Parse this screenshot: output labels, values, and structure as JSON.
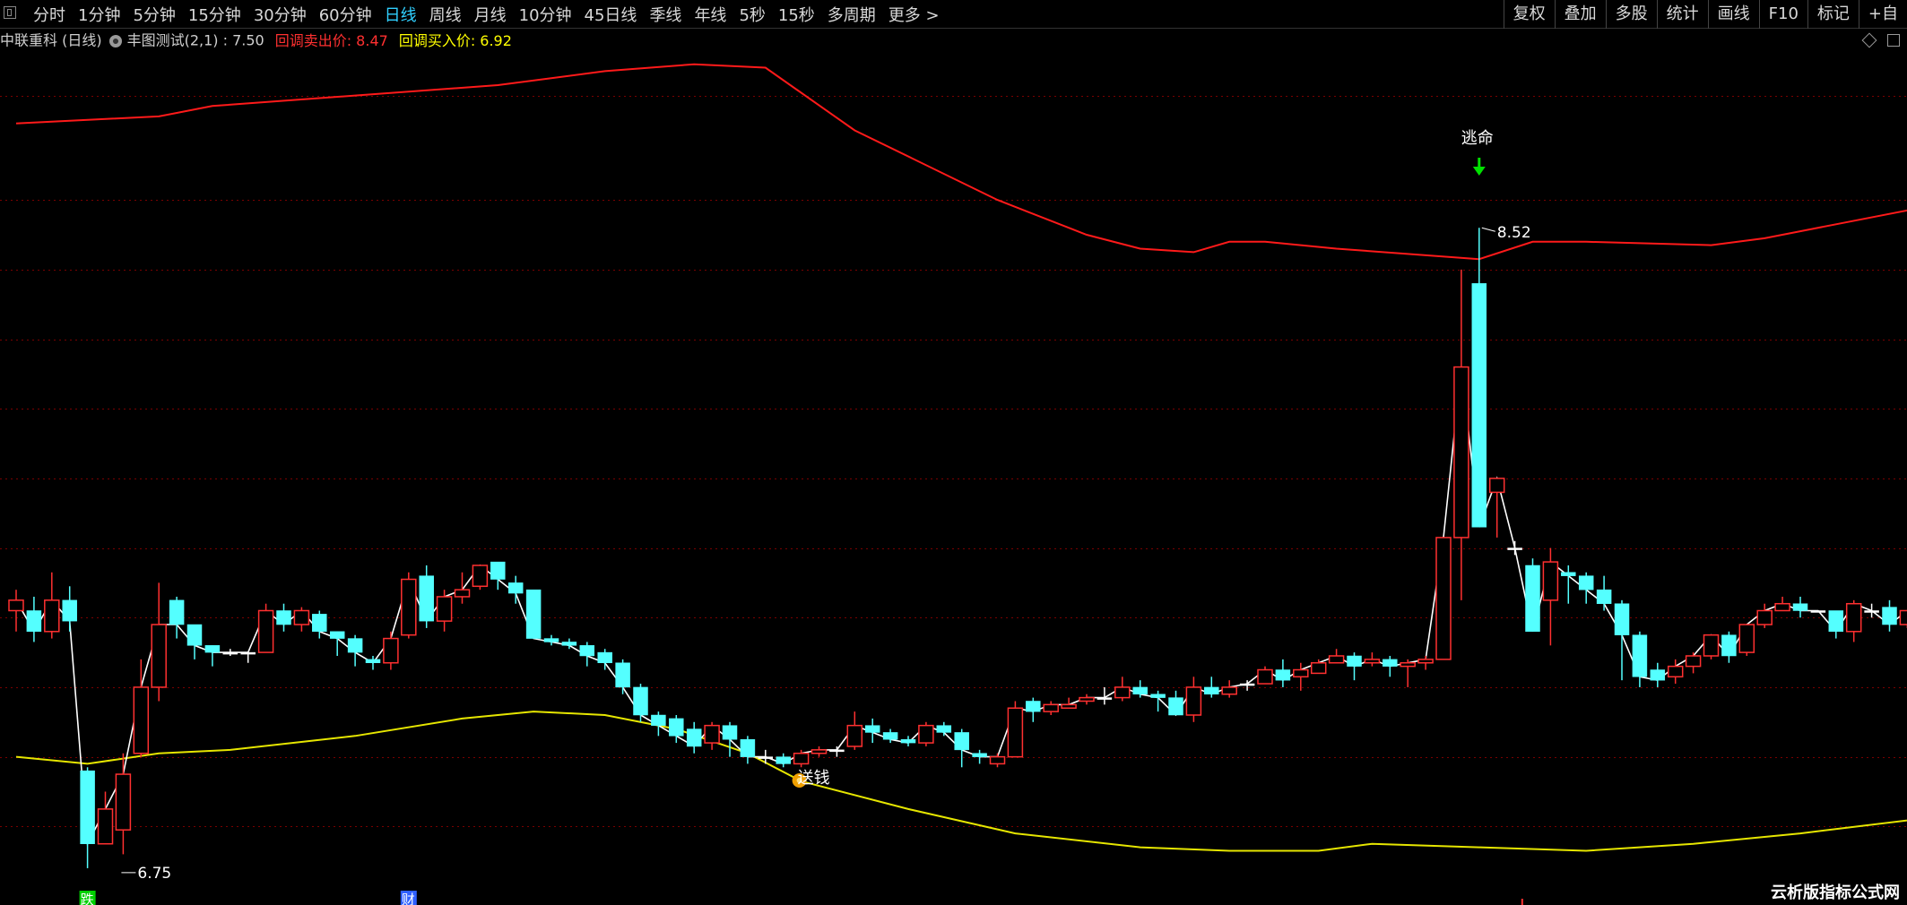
{
  "toolbar": {
    "periods": [
      "分时",
      "1分钟",
      "5分钟",
      "15分钟",
      "30分钟",
      "60分钟",
      "日线",
      "周线",
      "月线",
      "10分钟",
      "45日线",
      "季线",
      "年线",
      "5秒",
      "15秒",
      "多周期",
      "更多 >"
    ],
    "active_period": "日线",
    "right_buttons": [
      "复权",
      "叠加",
      "多股",
      "统计",
      "画线",
      "F10",
      "标记",
      "+自"
    ]
  },
  "info": {
    "stock": "中联重科 (日线)",
    "indicator": "丰图测试(2,1) : 7.50",
    "sell_label": "回调卖出价: 8.47",
    "buy_label": "回调买入价: 6.92"
  },
  "colors": {
    "up": "#ff3030",
    "down": "#54ffff",
    "upper_line": "#ff1a1a",
    "lower_line": "#e6e600",
    "close_line": "#ffffff",
    "grid": "#7a0000",
    "background": "#000000"
  },
  "chart_data": {
    "type": "candlestick",
    "ohlc": [
      [
        7.42,
        7.45,
        7.36,
        7.48
      ],
      [
        7.42,
        7.36,
        7.33,
        7.46
      ],
      [
        7.36,
        7.45,
        7.34,
        7.53
      ],
      [
        7.45,
        7.39,
        7.36,
        7.49
      ],
      [
        6.96,
        6.75,
        6.68,
        6.97
      ],
      [
        6.75,
        6.85,
        6.75,
        6.9
      ],
      [
        6.79,
        6.95,
        6.72,
        7.01
      ],
      [
        7.01,
        7.2,
        7.0,
        7.28
      ],
      [
        7.2,
        7.38,
        7.16,
        7.5
      ],
      [
        7.45,
        7.38,
        7.34,
        7.46
      ],
      [
        7.38,
        7.32,
        7.28,
        7.34
      ],
      [
        7.32,
        7.3,
        7.26,
        7.32
      ],
      [
        7.3,
        7.3,
        7.29,
        7.31
      ],
      [
        7.3,
        7.3,
        7.27,
        7.3
      ],
      [
        7.3,
        7.42,
        7.3,
        7.44
      ],
      [
        7.42,
        7.38,
        7.36,
        7.44
      ],
      [
        7.38,
        7.42,
        7.36,
        7.43
      ],
      [
        7.41,
        7.36,
        7.34,
        7.42
      ],
      [
        7.36,
        7.34,
        7.29,
        7.36
      ],
      [
        7.34,
        7.3,
        7.26,
        7.35
      ],
      [
        7.28,
        7.27,
        7.25,
        7.29
      ],
      [
        7.27,
        7.34,
        7.25,
        7.36
      ],
      [
        7.35,
        7.51,
        7.34,
        7.53
      ],
      [
        7.52,
        7.39,
        7.37,
        7.55
      ],
      [
        7.39,
        7.46,
        7.36,
        7.48
      ],
      [
        7.46,
        7.48,
        7.44,
        7.53
      ],
      [
        7.49,
        7.55,
        7.48,
        7.55
      ],
      [
        7.56,
        7.51,
        7.48,
        7.56
      ],
      [
        7.5,
        7.47,
        7.44,
        7.52
      ],
      [
        7.48,
        7.34,
        7.34,
        7.48
      ],
      [
        7.34,
        7.33,
        7.32,
        7.35
      ],
      [
        7.33,
        7.32,
        7.31,
        7.34
      ],
      [
        7.32,
        7.29,
        7.26,
        7.33
      ],
      [
        7.3,
        7.27,
        7.25,
        7.31
      ],
      [
        7.27,
        7.2,
        7.18,
        7.28
      ],
      [
        7.2,
        7.12,
        7.1,
        7.21
      ],
      [
        7.12,
        7.09,
        7.06,
        7.13
      ],
      [
        7.11,
        7.06,
        7.04,
        7.12
      ],
      [
        7.08,
        7.03,
        7.01,
        7.1
      ],
      [
        7.04,
        7.09,
        7.02,
        7.1
      ],
      [
        7.09,
        7.05,
        7.0,
        7.1
      ],
      [
        7.05,
        7.0,
        6.98,
        7.06
      ],
      [
        7.0,
        7.0,
        6.98,
        7.02
      ],
      [
        7.0,
        6.98,
        6.97,
        7.01
      ],
      [
        6.98,
        7.01,
        6.97,
        7.02
      ],
      [
        7.01,
        7.02,
        7.0,
        7.03
      ],
      [
        7.02,
        7.02,
        7.0,
        7.03
      ],
      [
        7.03,
        7.09,
        7.02,
        7.13
      ],
      [
        7.09,
        7.07,
        7.04,
        7.11
      ],
      [
        7.07,
        7.05,
        7.04,
        7.08
      ],
      [
        7.05,
        7.04,
        7.03,
        7.06
      ],
      [
        7.04,
        7.09,
        7.03,
        7.1
      ],
      [
        7.09,
        7.07,
        7.06,
        7.1
      ],
      [
        7.07,
        7.02,
        6.97,
        7.08
      ],
      [
        7.01,
        7.0,
        6.98,
        7.02
      ],
      [
        6.98,
        7.0,
        6.97,
        7.01
      ],
      [
        7.0,
        7.14,
        7.0,
        7.16
      ],
      [
        7.16,
        7.13,
        7.1,
        7.17
      ],
      [
        7.13,
        7.15,
        7.12,
        7.16
      ],
      [
        7.14,
        7.15,
        7.14,
        7.17
      ],
      [
        7.16,
        7.17,
        7.15,
        7.18
      ],
      [
        7.17,
        7.17,
        7.15,
        7.2
      ],
      [
        7.17,
        7.2,
        7.16,
        7.23
      ],
      [
        7.2,
        7.18,
        7.17,
        7.22
      ],
      [
        7.18,
        7.17,
        7.13,
        7.19
      ],
      [
        7.17,
        7.12,
        7.12,
        7.19
      ],
      [
        7.12,
        7.2,
        7.1,
        7.23
      ],
      [
        7.2,
        7.18,
        7.17,
        7.23
      ],
      [
        7.18,
        7.2,
        7.17,
        7.22
      ],
      [
        7.21,
        7.21,
        7.19,
        7.22
      ],
      [
        7.21,
        7.25,
        7.21,
        7.26
      ],
      [
        7.25,
        7.22,
        7.2,
        7.28
      ],
      [
        7.23,
        7.25,
        7.19,
        7.27
      ],
      [
        7.24,
        7.27,
        7.24,
        7.28
      ],
      [
        7.27,
        7.29,
        7.27,
        7.31
      ],
      [
        7.29,
        7.26,
        7.22,
        7.3
      ],
      [
        7.27,
        7.28,
        7.26,
        7.3
      ],
      [
        7.28,
        7.26,
        7.23,
        7.29
      ],
      [
        7.26,
        7.27,
        7.2,
        7.28
      ],
      [
        7.27,
        7.28,
        7.25,
        7.29
      ],
      [
        7.28,
        7.63,
        7.28,
        7.63
      ],
      [
        7.63,
        8.12,
        7.45,
        8.4
      ],
      [
        8.36,
        7.66,
        7.66,
        8.52
      ],
      [
        7.76,
        7.8,
        7.63,
        7.8
      ],
      [
        7.6,
        7.6,
        7.58,
        7.62
      ],
      [
        7.55,
        7.36,
        7.5,
        7.57
      ],
      [
        7.45,
        7.56,
        7.32,
        7.6
      ],
      [
        7.53,
        7.52,
        7.44,
        7.55
      ],
      [
        7.52,
        7.48,
        7.44,
        7.53
      ],
      [
        7.48,
        7.44,
        7.42,
        7.52
      ],
      [
        7.44,
        7.35,
        7.22,
        7.45
      ],
      [
        7.35,
        7.23,
        7.2,
        7.36
      ],
      [
        7.25,
        7.22,
        7.2,
        7.27
      ],
      [
        7.23,
        7.26,
        7.21,
        7.28
      ],
      [
        7.26,
        7.29,
        7.24,
        7.3
      ],
      [
        7.29,
        7.35,
        7.28,
        7.35
      ],
      [
        7.35,
        7.29,
        7.27,
        7.36
      ],
      [
        7.3,
        7.38,
        7.29,
        7.38
      ],
      [
        7.38,
        7.42,
        7.37,
        7.44
      ],
      [
        7.42,
        7.44,
        7.42,
        7.46
      ],
      [
        7.44,
        7.42,
        7.4,
        7.46
      ],
      [
        7.42,
        7.42,
        7.42,
        7.42
      ],
      [
        7.42,
        7.36,
        7.34,
        7.42
      ],
      [
        7.36,
        7.44,
        7.33,
        7.45
      ],
      [
        7.42,
        7.42,
        7.4,
        7.44
      ],
      [
        7.43,
        7.38,
        7.36,
        7.45
      ],
      [
        7.38,
        7.42,
        7.37,
        7.42
      ],
      [
        7.42,
        7.43,
        7.4,
        7.45
      ],
      [
        7.43,
        7.42,
        7.4,
        7.46
      ],
      [
        7.42,
        7.42,
        7.41,
        7.44
      ]
    ],
    "upper_band": [
      [
        0,
        8.82
      ],
      [
        8,
        8.84
      ],
      [
        11,
        8.87
      ],
      [
        19,
        8.9
      ],
      [
        27,
        8.93
      ],
      [
        33,
        8.97
      ],
      [
        38,
        8.99
      ],
      [
        42,
        8.98
      ],
      [
        47,
        8.8
      ],
      [
        55,
        8.6
      ],
      [
        60,
        8.5
      ],
      [
        63,
        8.46
      ],
      [
        66,
        8.45
      ],
      [
        68,
        8.48
      ],
      [
        70,
        8.48
      ],
      [
        74,
        8.46
      ],
      [
        82,
        8.43
      ],
      [
        85,
        8.48
      ],
      [
        88,
        8.48
      ],
      [
        95,
        8.47
      ],
      [
        98,
        8.49
      ],
      [
        102,
        8.53
      ],
      [
        108,
        8.59
      ]
    ],
    "lower_band": [
      [
        0,
        7.0
      ],
      [
        4,
        6.98
      ],
      [
        8,
        7.01
      ],
      [
        12,
        7.02
      ],
      [
        19,
        7.06
      ],
      [
        25,
        7.11
      ],
      [
        29,
        7.13
      ],
      [
        33,
        7.12
      ],
      [
        37,
        7.08
      ],
      [
        41,
        7.01
      ],
      [
        44,
        6.93
      ],
      [
        50,
        6.85
      ],
      [
        56,
        6.78
      ],
      [
        63,
        6.74
      ],
      [
        68,
        6.73
      ],
      [
        73,
        6.73
      ],
      [
        76,
        6.75
      ],
      [
        82,
        6.74
      ],
      [
        88,
        6.73
      ],
      [
        94,
        6.75
      ],
      [
        100,
        6.78
      ],
      [
        108,
        6.83
      ]
    ],
    "annotations": [
      {
        "text": "逃命",
        "bar": 82
      },
      {
        "text": "8.52",
        "bar": 82
      },
      {
        "text": "6.75",
        "bar": 6
      },
      {
        "text": "送钱",
        "bar": 44
      }
    ],
    "bottom_markers": [
      {
        "text": "跌",
        "color": "#00d000",
        "bar": 4
      },
      {
        "text": "财",
        "color": "#3060ff",
        "bar": 22
      }
    ]
  },
  "watermark": "云析版指标公式网"
}
